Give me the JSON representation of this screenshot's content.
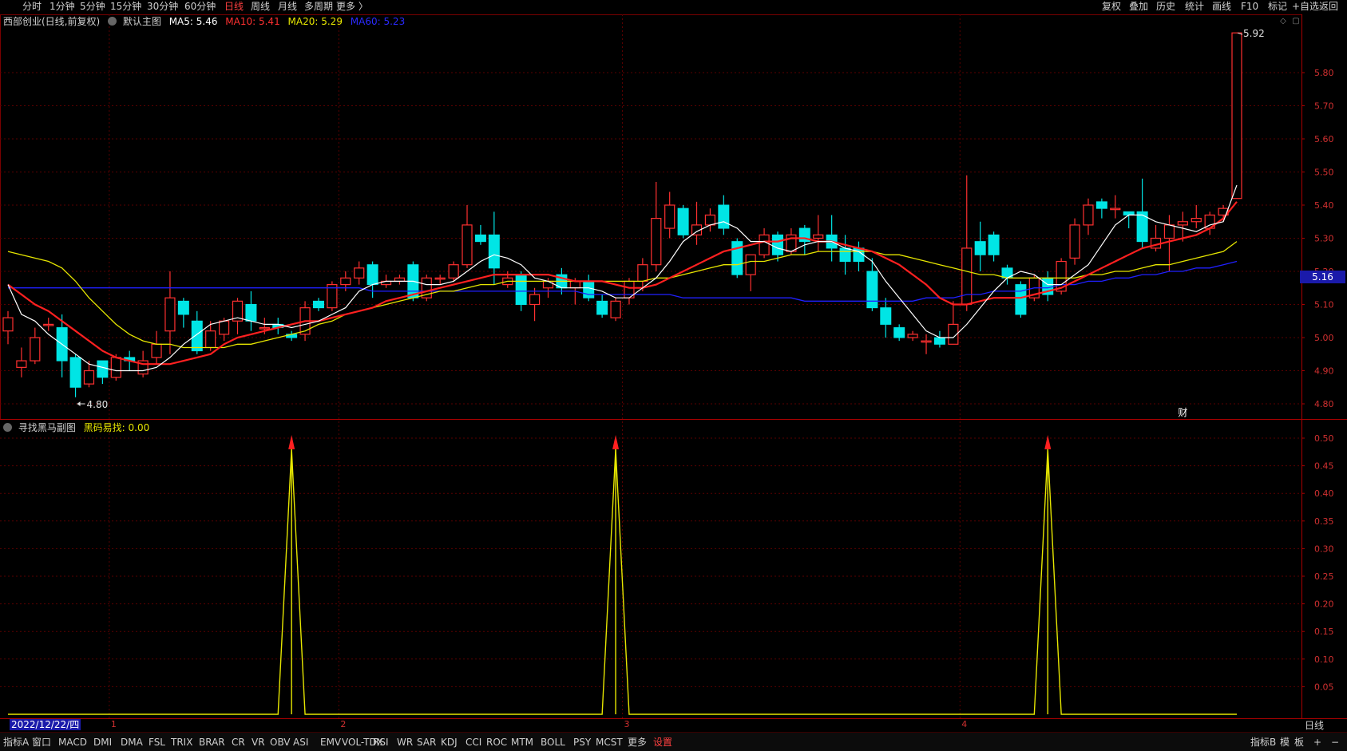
{
  "topbar": {
    "left_items": [
      "分时",
      "1分钟",
      "5分钟",
      "15分钟",
      "30分钟",
      "60分钟",
      "日线",
      "周线",
      "月线",
      "多周期",
      "更多 〉"
    ],
    "active_item": "日线",
    "right_items": [
      "复权",
      "叠加",
      "历史",
      "统计",
      "画线",
      "F10",
      "标记",
      "+自选",
      "返回"
    ]
  },
  "main_legend": {
    "stock": "西部创业(日线,前复权)",
    "template": "默认主图",
    "ma5": "MA5: 5.46",
    "ma10": "MA10: 5.41",
    "ma20": "MA20: 5.29",
    "ma60": "MA60: 5.23"
  },
  "sub_legend": {
    "name": "寻找黑马副图",
    "value": "黑码易找: 0.00"
  },
  "colors": {
    "up": "#ff3030",
    "down": "#00e5e5",
    "ma5": "#ffffff",
    "ma10": "#ff2020",
    "ma20": "#e6e600",
    "ma60": "#2020ff",
    "grid": "#5a0000",
    "sub_line": "#e6e600"
  },
  "price_axis": [
    "5.80",
    "5.70",
    "5.60",
    "5.50",
    "5.40",
    "5.30",
    "5.20",
    "5.10",
    "5.00",
    "4.90",
    "4.80"
  ],
  "sub_axis": [
    "0.50",
    "0.45",
    "0.40",
    "0.35",
    "0.30",
    "0.25",
    "0.20",
    "0.15",
    "0.10",
    "0.05"
  ],
  "annotations": {
    "high": "5.92",
    "low": "4.80",
    "current_price": "5.16",
    "fin_marker": "财"
  },
  "date_cursor": "2022/12/22/四",
  "period_label": "日线",
  "month_marks": [
    "1",
    "2",
    "3",
    "4"
  ],
  "bottombar": {
    "left_items": [
      "指标A",
      "窗口",
      "MACD",
      "DMI",
      "DMA",
      "FSL",
      "TRIX",
      "BRAR",
      "CR",
      "VR",
      "OBV",
      "ASI",
      "EMV",
      "VOL-TDX",
      "RSI",
      "WR",
      "SAR",
      "KDJ",
      "CCI",
      "ROC",
      "MTM",
      "BOLL",
      "PSY",
      "MCST",
      "更多",
      "设置"
    ],
    "right_items": [
      "指标B",
      "模",
      "板",
      "+",
      "−"
    ]
  },
  "candles": [
    [
      5.02,
      5.06,
      4.98,
      5.08
    ],
    [
      4.91,
      4.93,
      4.88,
      4.97
    ],
    [
      4.93,
      5.0,
      4.92,
      5.03
    ],
    [
      5.04,
      5.04,
      5.02,
      5.06
    ],
    [
      5.03,
      4.93,
      4.88,
      5.07
    ],
    [
      4.94,
      4.85,
      4.82,
      4.95
    ],
    [
      4.86,
      4.9,
      4.85,
      4.93
    ],
    [
      4.93,
      4.88,
      4.86,
      4.93
    ],
    [
      4.88,
      4.94,
      4.87,
      4.95
    ],
    [
      4.94,
      4.93,
      4.9,
      4.96
    ],
    [
      4.89,
      4.93,
      4.88,
      4.96
    ],
    [
      4.94,
      4.98,
      4.92,
      5.02
    ],
    [
      5.02,
      5.12,
      4.95,
      5.2
    ],
    [
      5.11,
      5.07,
      5.03,
      5.12
    ],
    [
      5.05,
      4.96,
      4.95,
      5.08
    ],
    [
      4.97,
      5.02,
      4.96,
      5.05
    ],
    [
      5.01,
      5.05,
      4.99,
      5.06
    ],
    [
      5.05,
      5.11,
      5.01,
      5.12
    ],
    [
      5.1,
      5.05,
      5.02,
      5.14
    ],
    [
      5.03,
      5.03,
      5.01,
      5.06
    ],
    [
      5.04,
      5.03,
      5.01,
      5.06
    ],
    [
      5.01,
      5.0,
      4.99,
      5.02
    ],
    [
      5.01,
      5.09,
      4.99,
      5.11
    ],
    [
      5.11,
      5.09,
      5.08,
      5.12
    ],
    [
      5.09,
      5.16,
      5.08,
      5.17
    ],
    [
      5.16,
      5.18,
      5.14,
      5.2
    ],
    [
      5.18,
      5.21,
      5.16,
      5.23
    ],
    [
      5.22,
      5.16,
      5.12,
      5.23
    ],
    [
      5.16,
      5.17,
      5.15,
      5.19
    ],
    [
      5.17,
      5.18,
      5.16,
      5.19
    ],
    [
      5.22,
      5.12,
      5.11,
      5.23
    ],
    [
      5.12,
      5.18,
      5.11,
      5.19
    ],
    [
      5.18,
      5.18,
      5.16,
      5.19
    ],
    [
      5.18,
      5.22,
      5.17,
      5.23
    ],
    [
      5.22,
      5.34,
      5.21,
      5.4
    ],
    [
      5.31,
      5.29,
      5.28,
      5.34
    ],
    [
      5.31,
      5.21,
      5.16,
      5.38
    ],
    [
      5.16,
      5.18,
      5.15,
      5.2
    ],
    [
      5.19,
      5.1,
      5.08,
      5.2
    ],
    [
      5.1,
      5.13,
      5.05,
      5.15
    ],
    [
      5.15,
      5.17,
      5.12,
      5.18
    ],
    [
      5.19,
      5.15,
      5.13,
      5.21
    ],
    [
      5.15,
      5.17,
      5.1,
      5.18
    ],
    [
      5.17,
      5.12,
      5.11,
      5.19
    ],
    [
      5.11,
      5.07,
      5.06,
      5.13
    ],
    [
      5.06,
      5.11,
      5.05,
      5.12
    ],
    [
      5.12,
      5.17,
      5.1,
      5.18
    ],
    [
      5.17,
      5.22,
      5.14,
      5.24
    ],
    [
      5.22,
      5.36,
      5.2,
      5.47
    ],
    [
      5.33,
      5.4,
      5.3,
      5.44
    ],
    [
      5.39,
      5.31,
      5.3,
      5.4
    ],
    [
      5.31,
      5.34,
      5.28,
      5.41
    ],
    [
      5.34,
      5.37,
      5.32,
      5.39
    ],
    [
      5.4,
      5.33,
      5.31,
      5.43
    ],
    [
      5.29,
      5.19,
      5.18,
      5.3
    ],
    [
      5.19,
      5.25,
      5.14,
      5.25
    ],
    [
      5.25,
      5.31,
      5.24,
      5.33
    ],
    [
      5.31,
      5.25,
      5.23,
      5.32
    ],
    [
      5.26,
      5.31,
      5.25,
      5.33
    ],
    [
      5.33,
      5.29,
      5.25,
      5.34
    ],
    [
      5.3,
      5.31,
      5.26,
      5.37
    ],
    [
      5.31,
      5.27,
      5.23,
      5.37
    ],
    [
      5.27,
      5.23,
      5.19,
      5.31
    ],
    [
      5.27,
      5.23,
      5.2,
      5.29
    ],
    [
      5.2,
      5.09,
      5.08,
      5.24
    ],
    [
      5.09,
      5.04,
      5.0,
      5.12
    ],
    [
      5.03,
      5.0,
      4.99,
      5.04
    ],
    [
      5.0,
      5.01,
      4.99,
      5.02
    ],
    [
      4.99,
      4.99,
      4.95,
      5.01
    ],
    [
      5.0,
      4.98,
      4.97,
      5.02
    ],
    [
      4.98,
      5.04,
      4.98,
      5.11
    ],
    [
      5.1,
      5.27,
      5.08,
      5.49
    ],
    [
      5.29,
      5.25,
      5.2,
      5.35
    ],
    [
      5.31,
      5.25,
      5.23,
      5.32
    ],
    [
      5.21,
      5.18,
      5.16,
      5.22
    ],
    [
      5.16,
      5.07,
      5.06,
      5.17
    ],
    [
      5.12,
      5.18,
      5.11,
      5.19
    ],
    [
      5.18,
      5.13,
      5.11,
      5.2
    ],
    [
      5.14,
      5.23,
      5.13,
      5.24
    ],
    [
      5.24,
      5.34,
      5.22,
      5.36
    ],
    [
      5.34,
      5.4,
      5.31,
      5.42
    ],
    [
      5.41,
      5.39,
      5.36,
      5.42
    ],
    [
      5.39,
      5.39,
      5.36,
      5.43
    ],
    [
      5.38,
      5.37,
      5.33,
      5.38
    ],
    [
      5.38,
      5.29,
      5.27,
      5.48
    ],
    [
      5.27,
      5.3,
      5.26,
      5.34
    ],
    [
      5.3,
      5.34,
      5.2,
      5.37
    ],
    [
      5.34,
      5.35,
      5.29,
      5.38
    ],
    [
      5.35,
      5.36,
      5.33,
      5.4
    ],
    [
      5.33,
      5.37,
      5.31,
      5.38
    ],
    [
      5.37,
      5.39,
      5.35,
      5.4
    ],
    [
      5.42,
      5.92,
      5.42,
      5.92
    ]
  ],
  "ma5": [
    5.16,
    5.07,
    5.05,
    5.01,
    4.98,
    4.95,
    4.92,
    4.91,
    4.9,
    4.9,
    4.9,
    4.91,
    4.94,
    4.98,
    5.01,
    5.04,
    5.05,
    5.06,
    5.05,
    5.04,
    5.04,
    5.03,
    5.04,
    5.05,
    5.07,
    5.09,
    5.14,
    5.16,
    5.17,
    5.17,
    5.17,
    5.16,
    5.16,
    5.17,
    5.2,
    5.23,
    5.25,
    5.24,
    5.22,
    5.18,
    5.17,
    5.15,
    5.15,
    5.15,
    5.14,
    5.12,
    5.12,
    5.15,
    5.18,
    5.23,
    5.29,
    5.32,
    5.34,
    5.35,
    5.33,
    5.29,
    5.29,
    5.27,
    5.26,
    5.28,
    5.29,
    5.29,
    5.27,
    5.26,
    5.23,
    5.17,
    5.12,
    5.07,
    5.02,
    5.0,
    5.0,
    5.04,
    5.09,
    5.14,
    5.18,
    5.2,
    5.19,
    5.16,
    5.16,
    5.19,
    5.22,
    5.28,
    5.34,
    5.37,
    5.37,
    5.35,
    5.34,
    5.33,
    5.32,
    5.34,
    5.35,
    5.46
  ],
  "ma10": [
    5.16,
    5.13,
    5.1,
    5.08,
    5.05,
    5.02,
    4.99,
    4.96,
    4.94,
    4.93,
    4.92,
    4.92,
    4.92,
    4.93,
    4.94,
    4.95,
    4.98,
    5.0,
    5.01,
    5.02,
    5.03,
    5.04,
    5.05,
    5.05,
    5.06,
    5.07,
    5.08,
    5.09,
    5.11,
    5.12,
    5.13,
    5.14,
    5.15,
    5.16,
    5.17,
    5.18,
    5.19,
    5.19,
    5.19,
    5.19,
    5.19,
    5.18,
    5.17,
    5.17,
    5.17,
    5.16,
    5.15,
    5.15,
    5.16,
    5.18,
    5.2,
    5.22,
    5.24,
    5.26,
    5.27,
    5.28,
    5.29,
    5.29,
    5.3,
    5.3,
    5.29,
    5.29,
    5.28,
    5.27,
    5.26,
    5.24,
    5.22,
    5.19,
    5.16,
    5.12,
    5.1,
    5.1,
    5.11,
    5.12,
    5.12,
    5.12,
    5.13,
    5.14,
    5.15,
    5.17,
    5.19,
    5.21,
    5.23,
    5.25,
    5.27,
    5.28,
    5.29,
    5.3,
    5.31,
    5.33,
    5.36,
    5.41
  ],
  "ma20": [
    5.26,
    5.25,
    5.24,
    5.23,
    5.21,
    5.17,
    5.12,
    5.08,
    5.04,
    5.01,
    4.99,
    4.98,
    4.98,
    4.97,
    4.97,
    4.97,
    4.97,
    4.98,
    4.98,
    4.99,
    5.0,
    5.01,
    5.02,
    5.04,
    5.05,
    5.07,
    5.08,
    5.09,
    5.1,
    5.11,
    5.12,
    5.13,
    5.14,
    5.14,
    5.15,
    5.16,
    5.16,
    5.17,
    5.17,
    5.17,
    5.17,
    5.17,
    5.17,
    5.17,
    5.17,
    5.17,
    5.17,
    5.17,
    5.18,
    5.18,
    5.19,
    5.2,
    5.21,
    5.22,
    5.22,
    5.23,
    5.23,
    5.24,
    5.25,
    5.25,
    5.26,
    5.26,
    5.26,
    5.26,
    5.26,
    5.25,
    5.25,
    5.24,
    5.23,
    5.22,
    5.21,
    5.2,
    5.19,
    5.19,
    5.18,
    5.18,
    5.18,
    5.18,
    5.18,
    5.18,
    5.19,
    5.19,
    5.2,
    5.2,
    5.21,
    5.22,
    5.22,
    5.23,
    5.24,
    5.25,
    5.26,
    5.29
  ],
  "ma60": [
    5.15,
    5.15,
    5.15,
    5.15,
    5.15,
    5.15,
    5.15,
    5.15,
    5.15,
    5.15,
    5.15,
    5.15,
    5.15,
    5.15,
    5.15,
    5.15,
    5.15,
    5.15,
    5.15,
    5.15,
    5.15,
    5.15,
    5.15,
    5.15,
    5.15,
    5.15,
    5.15,
    5.14,
    5.14,
    5.14,
    5.14,
    5.14,
    5.14,
    5.14,
    5.14,
    5.14,
    5.14,
    5.14,
    5.14,
    5.14,
    5.14,
    5.14,
    5.14,
    5.13,
    5.13,
    5.13,
    5.13,
    5.13,
    5.13,
    5.13,
    5.12,
    5.12,
    5.12,
    5.12,
    5.12,
    5.12,
    5.12,
    5.12,
    5.12,
    5.11,
    5.11,
    5.11,
    5.11,
    5.11,
    5.11,
    5.11,
    5.11,
    5.11,
    5.12,
    5.12,
    5.12,
    5.13,
    5.13,
    5.14,
    5.14,
    5.14,
    5.15,
    5.15,
    5.16,
    5.16,
    5.17,
    5.17,
    5.18,
    5.18,
    5.19,
    5.19,
    5.2,
    5.2,
    5.21,
    5.21,
    5.22,
    5.23
  ],
  "signals": [
    21,
    45,
    77
  ],
  "month_starts": [
    8,
    25,
    46,
    71
  ]
}
